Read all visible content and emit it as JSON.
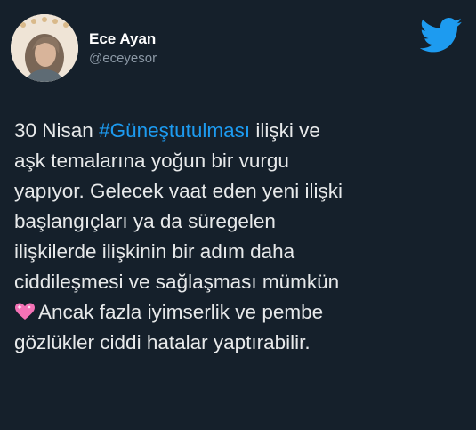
{
  "author": {
    "name": "Ece Ayan",
    "handle": "@eceyesor"
  },
  "icons": {
    "platform": "twitter-bird-icon",
    "emoji": "sparkling-heart-icon"
  },
  "colors": {
    "background": "#15202b",
    "text": "#e7e9ea",
    "hashtag": "#1d9bf0",
    "twitter_blue": "#1d9bf0"
  },
  "tweet": {
    "lines": [
      "ilişki ve",
      "aşk temalarına yoğun bir vurgu",
      "yapıyor. Gelecek vaat eden yeni ilişki",
      "başlangıçları ya da süregelen",
      "ilişkilerde ilişkinin bir adım daha",
      "ciddileşmesi ve sağlaşması mümkün",
      "Ancak fazla iyimserlik ve pembe",
      "gözlükler ciddi hatalar yaptırabilir."
    ],
    "prefix": "30 Nisan ",
    "hashtag": "#Güneştutulması"
  }
}
